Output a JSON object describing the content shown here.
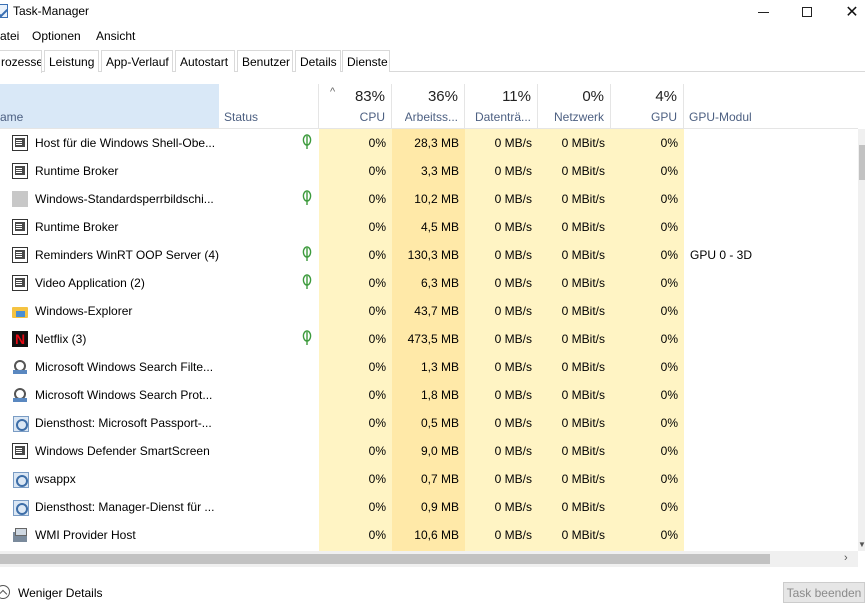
{
  "window": {
    "title": "Task-Manager"
  },
  "menu": [
    "atei",
    "Optionen",
    "Ansicht"
  ],
  "tabs": [
    "rozesse",
    "Leistung",
    "App-Verlauf",
    "Autostart",
    "Benutzer",
    "Details",
    "Dienste"
  ],
  "columns": {
    "name": "ame",
    "status": "Status",
    "cpu": {
      "pct": "83%",
      "label": "CPU"
    },
    "mem": {
      "pct": "36%",
      "label": "Arbeitss..."
    },
    "disk": {
      "pct": "11%",
      "label": "Datenträ..."
    },
    "net": {
      "pct": "0%",
      "label": "Netzwerk"
    },
    "gpu": {
      "pct": "4%",
      "label": "GPU"
    },
    "gpu_engine": "GPU-Modul"
  },
  "sort_caret": "^",
  "processes": [
    {
      "icon": "window-icon",
      "name": "Host für die Windows Shell-Obe...",
      "leaf": "⍦",
      "cpu": "0%",
      "mem": "28,3 MB",
      "disk": "0 MB/s",
      "net": "0 MBit/s",
      "gpu": "0%",
      "engine": ""
    },
    {
      "icon": "app-window-icon",
      "name": "Runtime Broker",
      "leaf": "",
      "cpu": "0%",
      "mem": "3,3 MB",
      "disk": "0 MB/s",
      "net": "0 MBit/s",
      "gpu": "0%",
      "engine": ""
    },
    {
      "icon": "gray-square-icon",
      "name": "Windows-Standardsperrbildschi...",
      "leaf": "⍦",
      "cpu": "0%",
      "mem": "10,2 MB",
      "disk": "0 MB/s",
      "net": "0 MBit/s",
      "gpu": "0%",
      "engine": ""
    },
    {
      "icon": "app-window-icon",
      "name": "Runtime Broker",
      "leaf": "",
      "cpu": "0%",
      "mem": "4,5 MB",
      "disk": "0 MB/s",
      "net": "0 MBit/s",
      "gpu": "0%",
      "engine": ""
    },
    {
      "icon": "app-window-icon",
      "name": "Reminders WinRT OOP Server (4)",
      "leaf": "⍦",
      "cpu": "0%",
      "mem": "130,3 MB",
      "disk": "0 MB/s",
      "net": "0 MBit/s",
      "gpu": "0%",
      "engine": "GPU 0 - 3D"
    },
    {
      "icon": "app-window-icon",
      "name": "Video Application (2)",
      "leaf": "⍦",
      "cpu": "0%",
      "mem": "6,3 MB",
      "disk": "0 MB/s",
      "net": "0 MBit/s",
      "gpu": "0%",
      "engine": ""
    },
    {
      "icon": "folder-icon",
      "name": "Windows-Explorer",
      "leaf": "",
      "cpu": "0%",
      "mem": "43,7 MB",
      "disk": "0 MB/s",
      "net": "0 MBit/s",
      "gpu": "0%",
      "engine": ""
    },
    {
      "icon": "netflix-icon",
      "name": "Netflix (3)",
      "leaf": "⍦",
      "cpu": "0%",
      "mem": "473,5 MB",
      "disk": "0 MB/s",
      "net": "0 MBit/s",
      "gpu": "0%",
      "engine": ""
    },
    {
      "icon": "search-icon",
      "name": "Microsoft Windows Search Filte...",
      "leaf": "",
      "cpu": "0%",
      "mem": "1,3 MB",
      "disk": "0 MB/s",
      "net": "0 MBit/s",
      "gpu": "0%",
      "engine": ""
    },
    {
      "icon": "search-icon",
      "name": "Microsoft Windows Search Prot...",
      "leaf": "",
      "cpu": "0%",
      "mem": "1,8 MB",
      "disk": "0 MB/s",
      "net": "0 MBit/s",
      "gpu": "0%",
      "engine": ""
    },
    {
      "icon": "gear-icon",
      "name": "Diensthost: Microsoft Passport-...",
      "leaf": "",
      "cpu": "0%",
      "mem": "0,5 MB",
      "disk": "0 MB/s",
      "net": "0 MBit/s",
      "gpu": "0%",
      "engine": ""
    },
    {
      "icon": "app-window-icon",
      "name": "Windows Defender SmartScreen",
      "leaf": "",
      "cpu": "0%",
      "mem": "9,0 MB",
      "disk": "0 MB/s",
      "net": "0 MBit/s",
      "gpu": "0%",
      "engine": ""
    },
    {
      "icon": "gear-icon",
      "name": "wsappx",
      "leaf": "",
      "cpu": "0%",
      "mem": "0,7 MB",
      "disk": "0 MB/s",
      "net": "0 MBit/s",
      "gpu": "0%",
      "engine": ""
    },
    {
      "icon": "gear-icon",
      "name": "Diensthost: Manager-Dienst für ...",
      "leaf": "",
      "cpu": "0%",
      "mem": "0,9 MB",
      "disk": "0 MB/s",
      "net": "0 MBit/s",
      "gpu": "0%",
      "engine": ""
    },
    {
      "icon": "wmi-icon",
      "name": "WMI Provider Host",
      "leaf": "",
      "cpu": "0%",
      "mem": "10,6 MB",
      "disk": "0 MB/s",
      "net": "0 MBit/s",
      "gpu": "0%",
      "engine": ""
    }
  ],
  "footer": {
    "less_details": "Weniger Details",
    "end_task": "Task beenden"
  },
  "colors": {
    "cpu_heat": "#fff4c4",
    "mem_heat": "#ffe9a8",
    "name_header": "#d9e8f7",
    "leaf": "#3c9a3c"
  }
}
